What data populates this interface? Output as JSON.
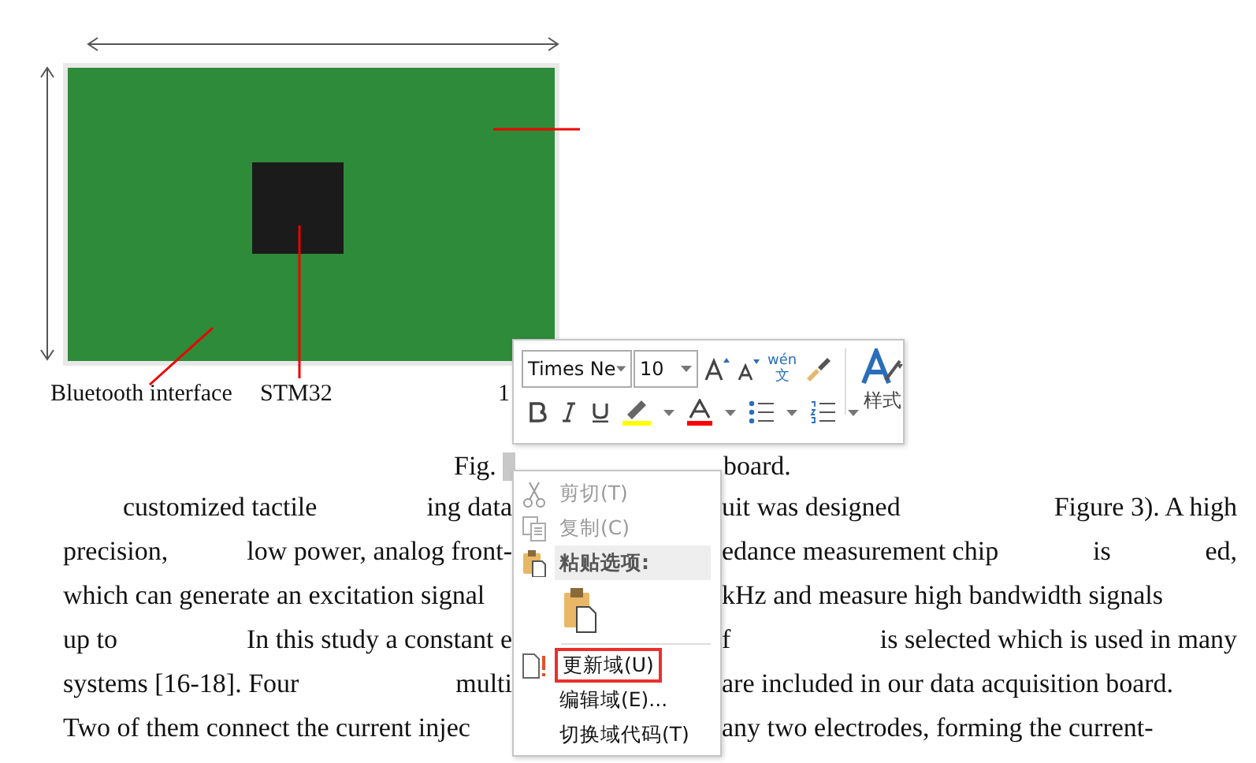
{
  "figure": {
    "labels": [
      "Bluetooth interface",
      "STM32",
      "1"
    ]
  },
  "caption": {
    "left": "Fig.",
    "right": "board."
  },
  "body_lines": [
    {
      "indent": true,
      "left": [
        "customized tactile",
        "ing data"
      ],
      "right": [
        "uit was designed",
        "Figure 3). A high"
      ]
    },
    {
      "indent": false,
      "left": [
        "precision,",
        "low power, analog front-"
      ],
      "right": [
        "edance measurement chip",
        "is",
        "ed,"
      ]
    },
    {
      "indent": false,
      "left": [
        "which can generate an excitation signal"
      ],
      "right": [
        "kHz and measure high bandwidth signals"
      ]
    },
    {
      "indent": false,
      "left": [
        "up to",
        "In this study a constant e"
      ],
      "right": [
        "f",
        "is selected which is used in many"
      ]
    },
    {
      "indent": false,
      "left": [
        "systems [16-18]. Four",
        "multi"
      ],
      "right": [
        "are included in our data acquisition board."
      ]
    },
    {
      "indent": false,
      "left": [
        "Two of them connect the current injec"
      ],
      "right": [
        "any two electrodes, forming the current-"
      ]
    }
  ],
  "mini_toolbar": {
    "font": "Times Ne",
    "size": "10",
    "phonetic_top": "wén",
    "phonetic_bottom": "文",
    "styles_label": "样式"
  },
  "context_menu": [
    {
      "kind": "cut",
      "label": "剪切(T)",
      "disabled": true,
      "boxed": false
    },
    {
      "kind": "copy",
      "label": "复制(C)",
      "disabled": true,
      "boxed": false
    },
    {
      "kind": "header",
      "label": "粘贴选项:"
    },
    {
      "kind": "paste"
    },
    {
      "kind": "separator"
    },
    {
      "kind": "update",
      "label": "更新域(U)",
      "disabled": false,
      "boxed": true
    },
    {
      "kind": "plain",
      "label": "编辑域(E)...",
      "disabled": false,
      "boxed": false
    },
    {
      "kind": "plain",
      "label": "切换域代码(T)",
      "disabled": false,
      "boxed": false
    }
  ]
}
